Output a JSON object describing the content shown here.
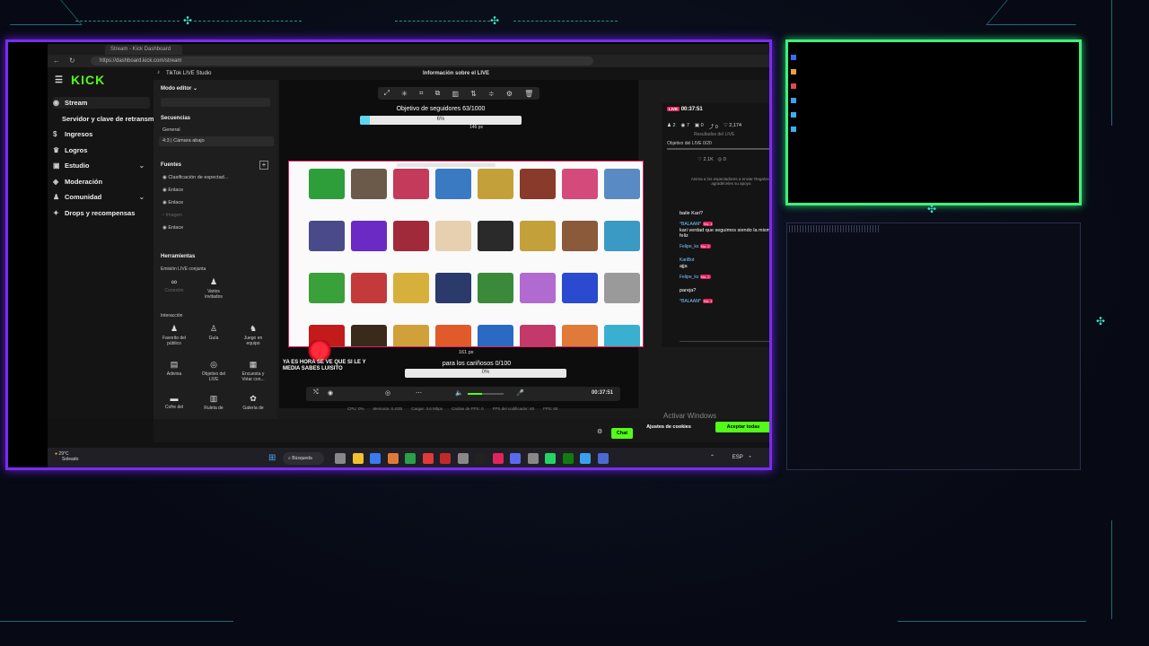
{
  "browser": {
    "tab_title": "Stream - Kick Dashboard",
    "url": "https://dashboard.kick.com/stream"
  },
  "kick": {
    "logo": "KICK",
    "nav": [
      {
        "label": "Stream",
        "icon": "stream-icon",
        "active": true
      },
      {
        "label": "Servidor y clave de retransmisión",
        "icon": "",
        "active": false
      },
      {
        "label": "Ingresos",
        "icon": "money-icon",
        "active": false
      },
      {
        "label": "Logros",
        "icon": "trophy-icon",
        "active": false
      },
      {
        "label": "Estudio",
        "icon": "studio-icon",
        "active": false,
        "chevron": true
      },
      {
        "label": "Moderación",
        "icon": "shield-icon",
        "active": false
      },
      {
        "label": "Comunidad",
        "icon": "community-icon",
        "active": false,
        "chevron": true
      },
      {
        "label": "Drops y recompensas",
        "icon": "gift-icon",
        "active": false
      }
    ]
  },
  "tiktok": {
    "app_title": "TikTok LIVE Studio",
    "center_title": "Información sobre el LIVE",
    "mode": "Modo editor",
    "sequences_title": "Secuencias",
    "sequence_general": "General",
    "sequence_selected": "4:3 | Cámara abajo",
    "sources_title": "Fuentes",
    "sources": [
      "Clasificación de espectad...",
      "Enlace",
      "Enlace",
      "Imagen",
      "Enlace"
    ],
    "tools_title": "Herramientas",
    "joint_title": "Emisión LIVE conjunta",
    "joint_tools": [
      "Conexión",
      "Varios invitados"
    ],
    "interaction_title": "Interacción",
    "interaction_tools": [
      "Favorito del público",
      "Guía",
      "Juego en equipo",
      "Adivina",
      "Objetivo del LIVE",
      "Encuesta y Votar con...",
      "Cofre del",
      "Ruleta de",
      "Galería de"
    ],
    "goal_top_label": "Objetivo de seguidores 63/1000",
    "goal_top_pct": "6%",
    "goal_top_fraction": 0.06,
    "px_top": "146 px",
    "goal_bottom_label": "para los cariñosos 0/100",
    "goal_bottom_pct": "0%",
    "px_bottom": "161 px",
    "sticker_text": "YA ES HORA SE VE QUE SI LE Y MEDIA SABES LUISITO",
    "playback_time": "00:37:51",
    "stats": [
      "CPU: 0%",
      "Memoria: 0.4GB",
      "Cargar: 3.6 Mbps",
      "Caídas de FPS: 0",
      "FPS del codificador: 60",
      "FPS: 60"
    ],
    "chat_button": "Chat"
  },
  "tt_panel": {
    "live_badge": "LIVE",
    "timer": "00:37:51",
    "stats": [
      "2",
      "7",
      "0",
      "0",
      "2,174"
    ],
    "results_title": "Resultados del LIVE",
    "goal": "Objetivo del LIVE 0/20",
    "likes": "2.1K",
    "hearts": "0",
    "encourage": "Anima a los espectadores a enviar Regalos y agradéceles su apoyo.",
    "messages": [
      {
        "user": "",
        "text": "baile Kari?"
      },
      {
        "user": "°BALAAM°",
        "badge": "No. 1",
        "text": "kari verdad que seguimos siendo la misma pareja feliz"
      },
      {
        "user": "Felipe_ks",
        "badge": "No. 2",
        "text": ""
      },
      {
        "user": "KariBot",
        "badge": "",
        "text": "ajja"
      },
      {
        "user": "Felipe_ks",
        "badge": "No. 2",
        "text": ""
      },
      {
        "user": "",
        "text": "pareja?"
      },
      {
        "user": "°BALAAM°",
        "badge": "No. 1",
        "text": ""
      }
    ]
  },
  "cookies": {
    "settings": "Ajustes de cookies",
    "accept": "Aceptar todas"
  },
  "windows": {
    "activate": "Activar Windows",
    "weather_temp": "29°C",
    "weather_desc": "Soleado",
    "search": "Búsqueda",
    "lang": "ESP"
  },
  "colors": {
    "frame_purple": "#7a2cf0",
    "cam_green": "#3ef07a",
    "kick_green": "#53fc18",
    "tiktok_red": "#e0245e"
  }
}
